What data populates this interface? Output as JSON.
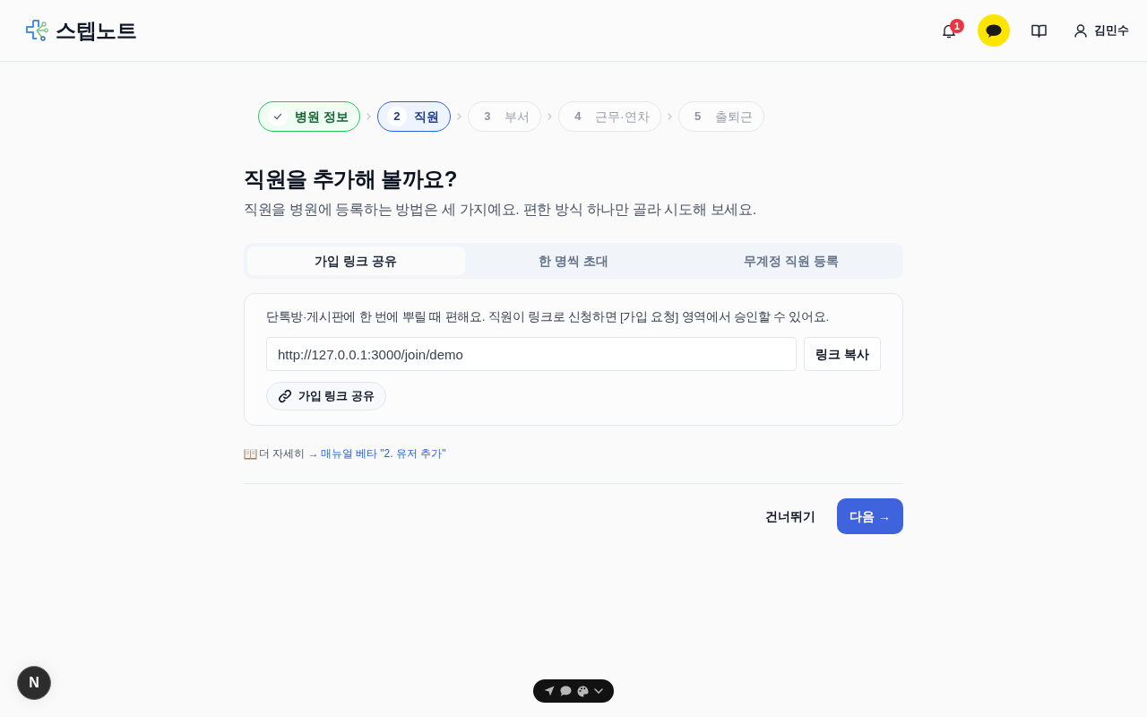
{
  "header": {
    "brand": "스텝노트",
    "notifications": {
      "count": "1"
    },
    "user": {
      "name": "김민수"
    }
  },
  "steps": [
    {
      "label": "병원 정보",
      "completed": true,
      "selected": false
    },
    {
      "number": "2",
      "label": "직원",
      "completed": false,
      "selected": true
    },
    {
      "number": "3",
      "label": "부서",
      "completed": false,
      "selected": false
    },
    {
      "number": "4",
      "label": "근무·연차",
      "completed": false,
      "selected": false
    },
    {
      "number": "5",
      "label": "출퇴근",
      "completed": false,
      "selected": false
    }
  ],
  "heading": {
    "title": "직원을 추가해 볼까요?",
    "subtitle": "직원을 병원에 등록하는 방법은 세 가지예요. 편한 방식 하나만 골라 시도해 보세요."
  },
  "tabs": [
    {
      "label": "가입 링크 공유",
      "selected": true
    },
    {
      "label": "한 명씩 초대",
      "selected": false
    },
    {
      "label": "무계정 직원 등록",
      "selected": false
    }
  ],
  "link_panel": {
    "description": "단톡방·게시판에 한 번에 뿌릴 때 편해요. 직원이 링크로 신청하면 [가입 요청] 영역에서 승인할 수 있어요.",
    "link_field": {
      "value": "http://127.0.0.1:3000/join/demo"
    },
    "copy_button": "링크 복사",
    "share_button": "가입 링크 공유"
  },
  "help": {
    "lead": "더 자세히 →",
    "link": "매뉴얼 베타 \"2. 유저 추가\""
  },
  "footer": {
    "skip_button": "건너뛰기",
    "next_button": "다음 →"
  },
  "dev_badge": {
    "label": "N"
  }
}
